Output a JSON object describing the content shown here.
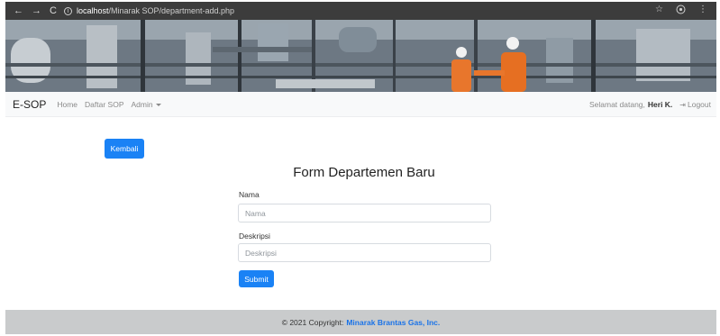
{
  "browser": {
    "back": "←",
    "forward": "→",
    "reload": "C",
    "url_host": "localhost",
    "url_path": "/Minarak SOP/department-add.php",
    "star": "☆",
    "menu": "⋮"
  },
  "navbar": {
    "brand": "E-SOP",
    "links": [
      "Home",
      "Daftar SOP",
      "Admin"
    ],
    "greeting": "Selamat datang,",
    "user": "Heri K.",
    "logout": "Logout"
  },
  "back_button": "Kembali",
  "form": {
    "title": "Form Departemen Baru",
    "name_label": "Nama",
    "name_placeholder": "Nama",
    "desc_label": "Deskripsi",
    "desc_placeholder": "Deskripsi",
    "submit": "Submit"
  },
  "footer": {
    "copyright": "© 2021 Copyright:",
    "company": "Minarak Brantas Gas, Inc."
  },
  "colors": {
    "primary": "#1a82f5",
    "footer_bg": "#c9cbcc",
    "browser_bar": "#3c3c3c"
  }
}
